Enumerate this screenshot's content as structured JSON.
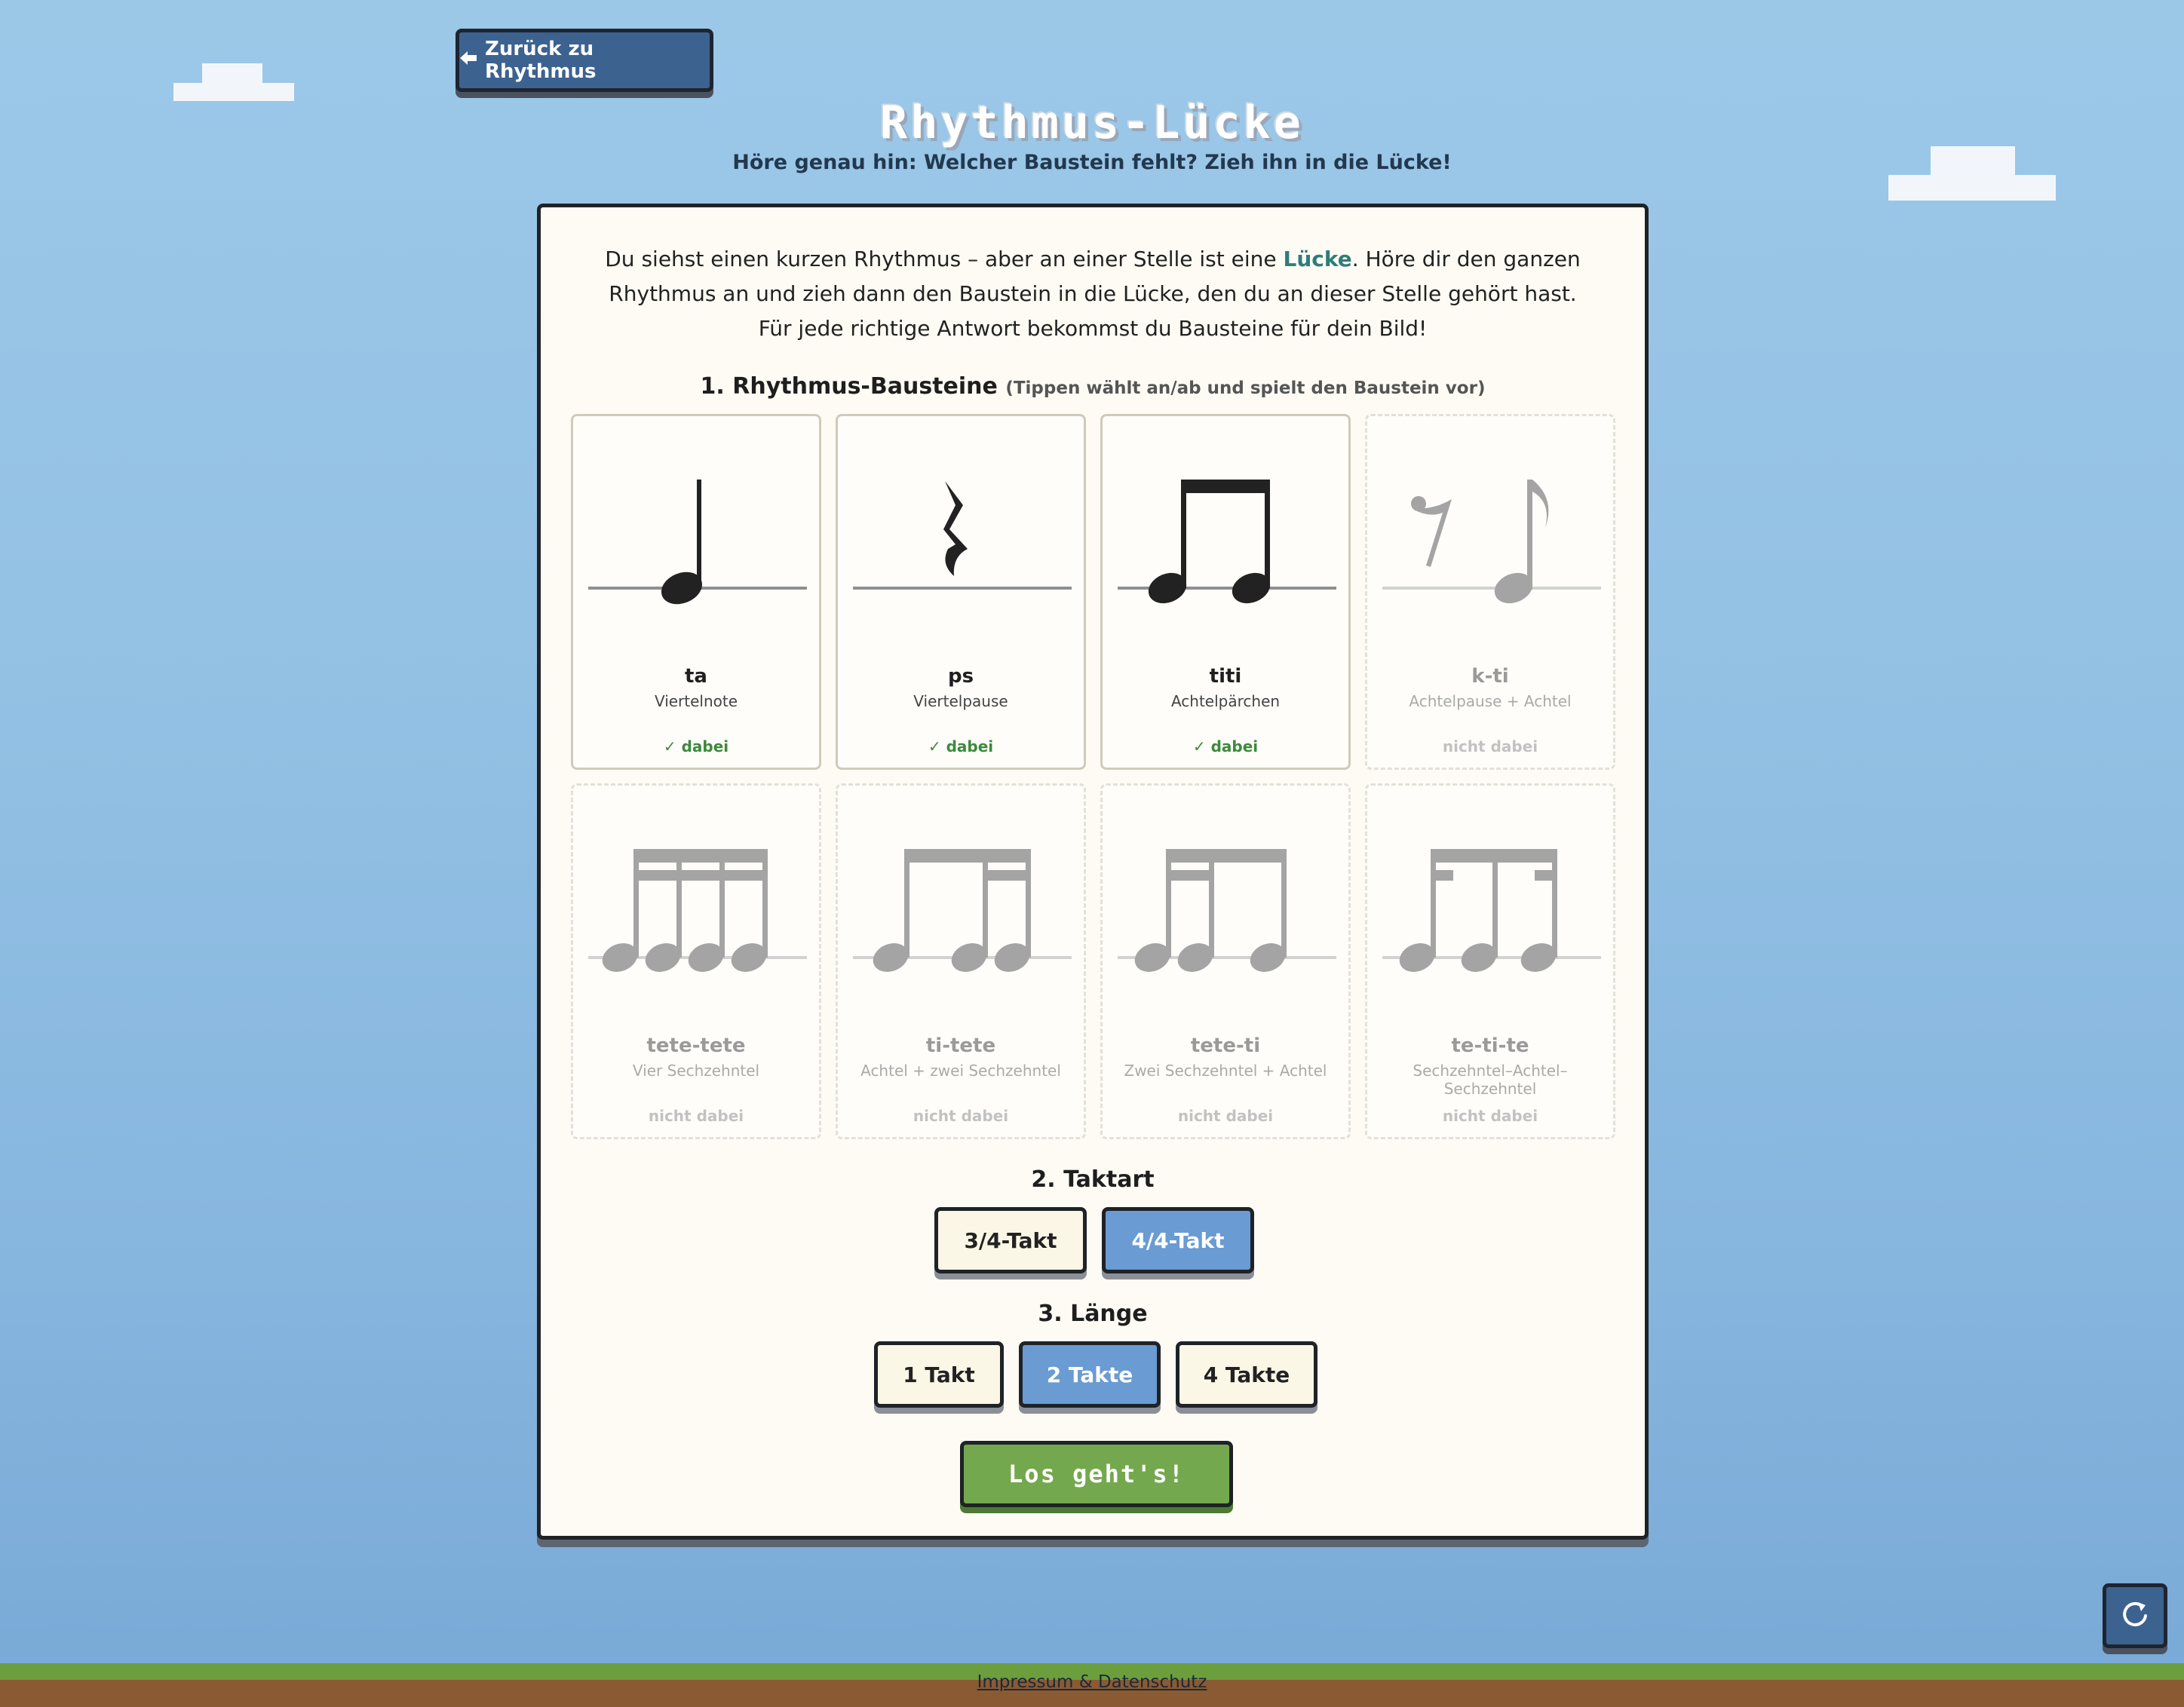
{
  "nav": {
    "back_label": "Zurück zu Rhythmus"
  },
  "header": {
    "title": "Rhythmus-Lücke",
    "subtitle": "Höre genau hin: Welcher Baustein fehlt? Zieh ihn in die Lücke!"
  },
  "intro": {
    "part1": "Du siehst einen kurzen Rhythmus – aber an einer Stelle ist eine ",
    "highlight": "Lücke",
    "part2": ". Höre dir den ganzen",
    "line2": "Rhythmus an und zieh dann den Baustein in die Lücke, den du an dieser Stelle gehört hast.",
    "line3": "Für jede richtige Antwort bekommst du Bausteine für dein Bild!"
  },
  "bausteine": {
    "heading": "1. Rhythmus-Bausteine",
    "hint": "(Tippen wählt an/ab und spielt den Baustein vor)",
    "tiles": [
      {
        "name": "ta",
        "sub": "Viertelnote",
        "status": "✓ dabei",
        "active": true,
        "icon": "quarter-note-icon"
      },
      {
        "name": "ps",
        "sub": "Viertelpause",
        "status": "✓ dabei",
        "active": true,
        "icon": "quarter-rest-icon"
      },
      {
        "name": "titi",
        "sub": "Achtelpärchen",
        "status": "✓ dabei",
        "active": true,
        "icon": "eighth-pair-icon"
      },
      {
        "name": "k-ti",
        "sub": "Achtelpause + Achtel",
        "status": "nicht dabei",
        "active": false,
        "icon": "eighth-rest-eighth-icon"
      },
      {
        "name": "tete-tete",
        "sub": "Vier Sechzehntel",
        "status": "nicht dabei",
        "active": false,
        "icon": "four-sixteenths-icon"
      },
      {
        "name": "ti-tete",
        "sub": "Achtel + zwei Sechzehntel",
        "status": "nicht dabei",
        "active": false,
        "icon": "eighth-two-sixteenths-icon"
      },
      {
        "name": "tete-ti",
        "sub": "Zwei Sechzehntel + Achtel",
        "status": "nicht dabei",
        "active": false,
        "icon": "two-sixteenths-eighth-icon"
      },
      {
        "name": "te-ti-te",
        "sub": "Sechzehntel–Achtel–Sechzehntel",
        "status": "nicht dabei",
        "active": false,
        "icon": "sixteenth-eighth-sixteenth-icon"
      }
    ]
  },
  "taktart": {
    "heading": "2. Taktart",
    "options": [
      {
        "label": "3/4-Takt",
        "selected": false
      },
      {
        "label": "4/4-Takt",
        "selected": true
      }
    ]
  },
  "laenge": {
    "heading": "3. Länge",
    "options": [
      {
        "label": "1 Takt",
        "selected": false
      },
      {
        "label": "2 Takte",
        "selected": true
      },
      {
        "label": "4 Takte",
        "selected": false
      }
    ]
  },
  "start_label": "Los geht's!",
  "footer": {
    "link": "Impressum & Datenschutz"
  },
  "colors": {
    "accent_blue": "#3c6290",
    "selected_blue": "#6a9bd3",
    "go_green": "#74a84e",
    "highlight_teal": "#2f7d7a",
    "dabei_green": "#3c8a3c"
  }
}
